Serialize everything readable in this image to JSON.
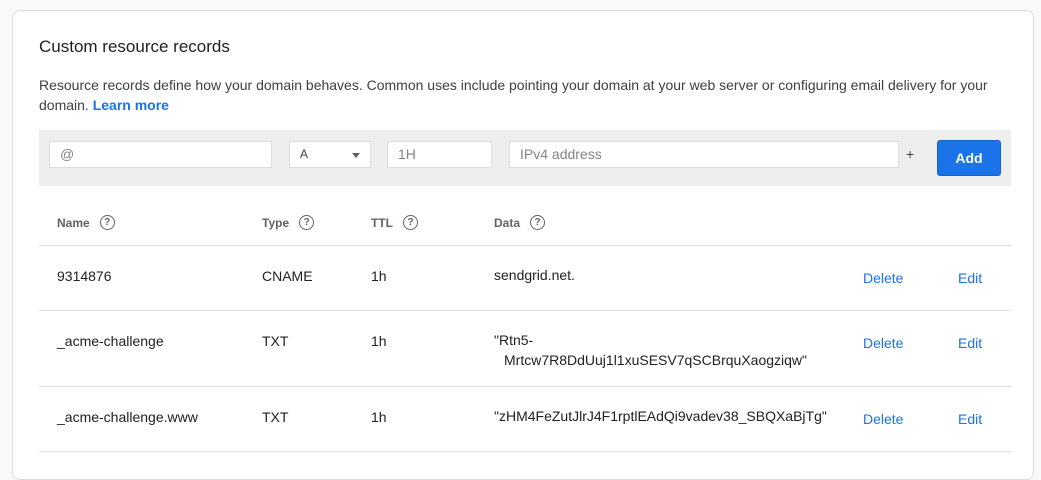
{
  "section": {
    "title": "Custom resource records",
    "description": "Resource records define how your domain behaves. Common uses include pointing your domain at your web server or configuring email delivery for your domain.",
    "learn_more": "Learn more"
  },
  "add_form": {
    "name_placeholder": "@",
    "type_value": "A",
    "ttl_placeholder": "1H",
    "data_placeholder": "IPv4 address",
    "plus": "+",
    "add_label": "Add"
  },
  "table": {
    "headers": [
      "Name",
      "Type",
      "TTL",
      "Data"
    ],
    "help_glyph": "?",
    "rows": [
      {
        "name": "9314876",
        "type": "CNAME",
        "ttl": "1h",
        "data_line1": "sendgrid.net.",
        "data_line2": "",
        "delete": "Delete",
        "edit": "Edit"
      },
      {
        "name": "_acme-challenge",
        "type": "TXT",
        "ttl": "1h",
        "data_line1": "\"Rtn5-",
        "data_line2": "Mrtcw7R8DdUuj1l1xuSESV7qSCBrquXaogziqw\"",
        "delete": "Delete",
        "edit": "Edit"
      },
      {
        "name": "_acme-challenge.www",
        "type": "TXT",
        "ttl": "1h",
        "data_line1": "\"zHM4FeZutJlrJ4F1rptlEAdQi9vadev38_SBQXaBjTg\"",
        "data_line2": "",
        "delete": "Delete",
        "edit": "Edit"
      }
    ]
  },
  "colors": {
    "accent": "#1a73e8",
    "divider": "#e0e0e0",
    "add_bar": "#eeeeee"
  }
}
